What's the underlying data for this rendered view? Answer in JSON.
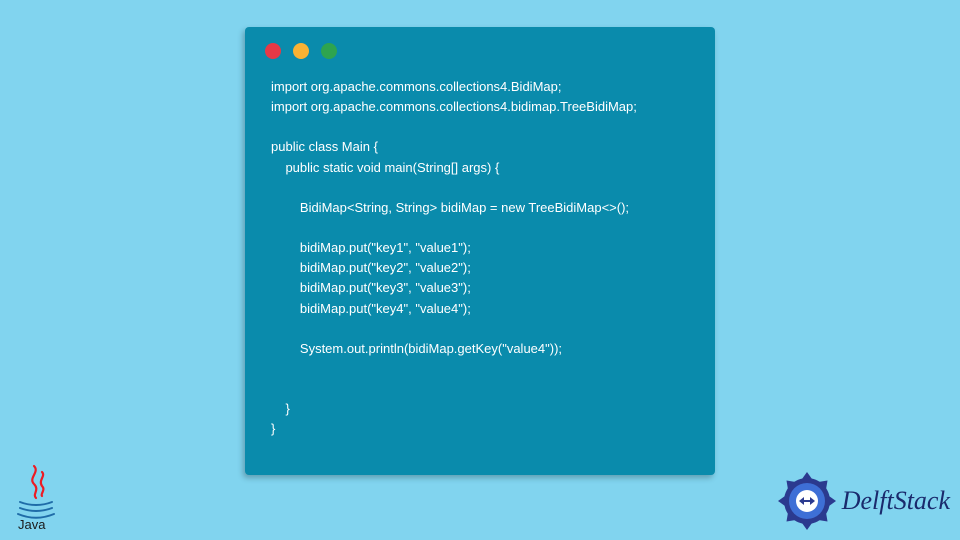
{
  "window": {
    "buttons": {
      "red": "close",
      "yellow": "minimize",
      "green": "maximize"
    }
  },
  "code": {
    "lines": [
      "import org.apache.commons.collections4.BidiMap;",
      "import org.apache.commons.collections4.bidimap.TreeBidiMap;",
      "",
      "public class Main {",
      "    public static void main(String[] args) {",
      "",
      "        BidiMap<String, String> bidiMap = new TreeBidiMap<>();",
      "",
      "        bidiMap.put(\"key1\", \"value1\");",
      "        bidiMap.put(\"key2\", \"value2\");",
      "        bidiMap.put(\"key3\", \"value3\");",
      "        bidiMap.put(\"key4\", \"value4\");",
      "",
      "        System.out.println(bidiMap.getKey(\"value4\"));",
      "",
      "",
      "    }",
      "}"
    ]
  },
  "logos": {
    "java_label": "Java",
    "brand_name": "DelftStack"
  }
}
